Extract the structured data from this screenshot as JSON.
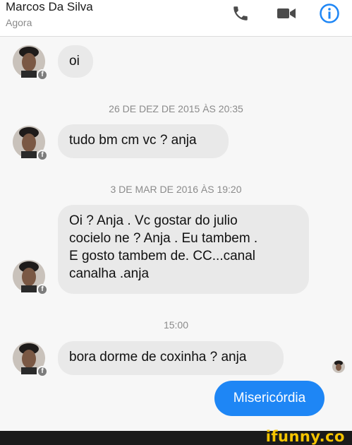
{
  "header": {
    "contact_name": "Marcos Da Silva",
    "status": "Agora",
    "icons": [
      "phone-icon",
      "video-icon",
      "info-icon"
    ],
    "accent_color": "#1e86f5"
  },
  "messages": [
    {
      "from": "contact",
      "text": "oi"
    },
    {
      "from": "contact",
      "text": "tudo bm cm vc ? anja"
    },
    {
      "from": "contact",
      "lines": [
        "Oi ? Anja . Vc gostar do julio",
        "cocielo ne ? Anja . Eu tambem .",
        "E gosto tambem de. CC...canal",
        "canalha .anja"
      ]
    },
    {
      "from": "contact",
      "text": "bora dorme de coxinha ? anja"
    },
    {
      "from": "me",
      "text": "Misericórdia"
    }
  ],
  "timestamps": [
    "26 DE DEZ DE 2015 ÀS 20:35",
    "3 DE MAR DE 2016 ÀS 19:20",
    "15:00"
  ],
  "avatar_badge": "f",
  "watermark": "ifunny.co"
}
